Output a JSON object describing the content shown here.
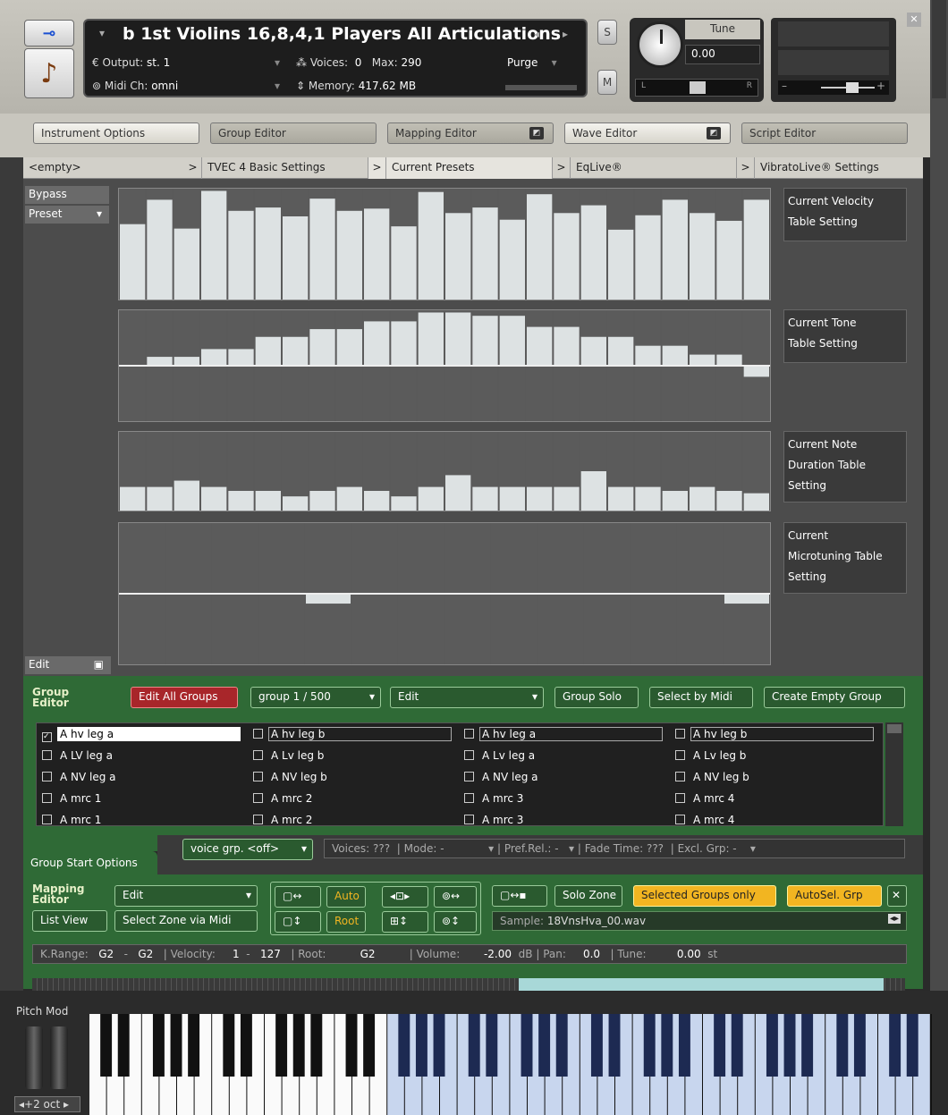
{
  "header": {
    "title": "b 1st Violins 16,8,4,1 Players All Articulations",
    "output_label": "Output:",
    "output_value": "st. 1",
    "voices_label": "Voices:",
    "voices_value": "0",
    "max_label": "Max:",
    "max_value": "290",
    "purge": "Purge",
    "midi_label": "Midi Ch:",
    "midi_value": "omni",
    "memory_label": "Memory:",
    "memory_value": "417.62 MB",
    "s_btn": "S",
    "m_btn": "M",
    "tune_label": "Tune",
    "tune_value": "0.00",
    "pan_l": "L",
    "pan_r": "R"
  },
  "tabs": {
    "instrument_options": "Instrument Options",
    "group_editor": "Group Editor",
    "mapping_editor": "Mapping Editor",
    "wave_editor": "Wave Editor",
    "script_editor": "Script Editor"
  },
  "script_tabs": [
    "<empty>",
    "TVEC 4 Basic Settings",
    "Current Presets",
    "EqLive®",
    "VibratoLive® Settings"
  ],
  "script_panel": {
    "bypass": "Bypass",
    "preset": "Preset",
    "edit": "Edit",
    "tables": [
      {
        "label": "Current Velocity\nTable Setting",
        "values": [
          0.68,
          0.9,
          0.64,
          0.98,
          0.8,
          0.83,
          0.75,
          0.91,
          0.8,
          0.82,
          0.66,
          0.97,
          0.78,
          0.83,
          0.72,
          0.95,
          0.78,
          0.85,
          0.63,
          0.76,
          0.9,
          0.78,
          0.71,
          0.9
        ],
        "type": "bipolar_up"
      },
      {
        "label": "Current Tone\nTable Setting",
        "values": [
          0,
          0.08,
          0.08,
          0.15,
          0.15,
          0.26,
          0.26,
          0.33,
          0.33,
          0.4,
          0.4,
          0.48,
          0.48,
          0.45,
          0.45,
          0.35,
          0.35,
          0.26,
          0.26,
          0.18,
          0.18,
          0.1,
          0.1,
          -0.1
        ],
        "type": "bipolar"
      },
      {
        "label": "Current Note\nDuration Table\nSetting",
        "values": [
          0.3,
          0.3,
          0.38,
          0.3,
          0.25,
          0.25,
          0.18,
          0.25,
          0.3,
          0.25,
          0.18,
          0.3,
          0.45,
          0.3,
          0.3,
          0.3,
          0.3,
          0.5,
          0.3,
          0.3,
          0.25,
          0.3,
          0.25,
          0.22
        ],
        "type": "bottom"
      },
      {
        "label": "Current\nMicrotuning Table\nSetting",
        "values": [
          0,
          0,
          0,
          0,
          -0.07,
          0,
          0,
          0,
          0,
          0,
          0,
          0,
          0,
          -0.07
        ],
        "type": "bipolar"
      }
    ]
  },
  "group_editor": {
    "title1": "Group",
    "title2": "Editor",
    "edit_all": "Edit All Groups",
    "group_sel": "group 1 / 500",
    "edit": "Edit",
    "solo": "Group Solo",
    "sel_midi": "Select by Midi",
    "create": "Create Empty Group",
    "groups": [
      [
        "A hv leg a",
        "A hv leg b",
        "A hv leg a",
        "A hv leg b"
      ],
      [
        "A LV leg a",
        "A Lv leg b",
        "A Lv leg a",
        "A Lv leg b"
      ],
      [
        "A NV leg a",
        "A NV leg b",
        "A NV leg a",
        "A NV leg b"
      ],
      [
        "A mrc 1",
        "A mrc 2",
        "A mrc 3",
        "A mrc 4"
      ],
      [
        "A mrc 1",
        "A mrc 2",
        "A mrc 3",
        "A mrc 4"
      ]
    ]
  },
  "group_start": {
    "label": "Group Start Options",
    "voice_grp": "voice grp. <off>",
    "voices": "Voices: ???",
    "mode": "Mode: -",
    "pref_rel": "Pref.Rel.: -",
    "fade": "Fade Time:   ???",
    "excl": "Excl. Grp: -"
  },
  "mapping": {
    "title1": "Mapping",
    "title2": "Editor",
    "edit": "Edit",
    "list_view": "List View",
    "select_zone": "Select Zone via Midi",
    "auto": "Auto",
    "root": "Root",
    "solo_zone": "Solo Zone",
    "selected_groups": "Selected Groups only",
    "autosel": "AutoSel. Grp",
    "sample_label": "Sample:",
    "sample_value": "18VnsHva_00.wav",
    "krange_label": "K.Range:",
    "krange_lo": "G2",
    "krange_hi": "G2",
    "vel_label": "Velocity:",
    "vel_lo": "1",
    "vel_hi": "127",
    "root_label": "Root:",
    "root_value": "G2",
    "vol_label": "Volume:",
    "vol_value": "-2.00",
    "vol_unit": "dB",
    "pan_label": "Pan:",
    "pan_value": "0.0",
    "tune_label": "Tune:",
    "tune_value": "0.00",
    "tune_unit": "st"
  },
  "keyboard": {
    "pitch_mod": "Pitch Mod",
    "octave": "+2 oct"
  }
}
